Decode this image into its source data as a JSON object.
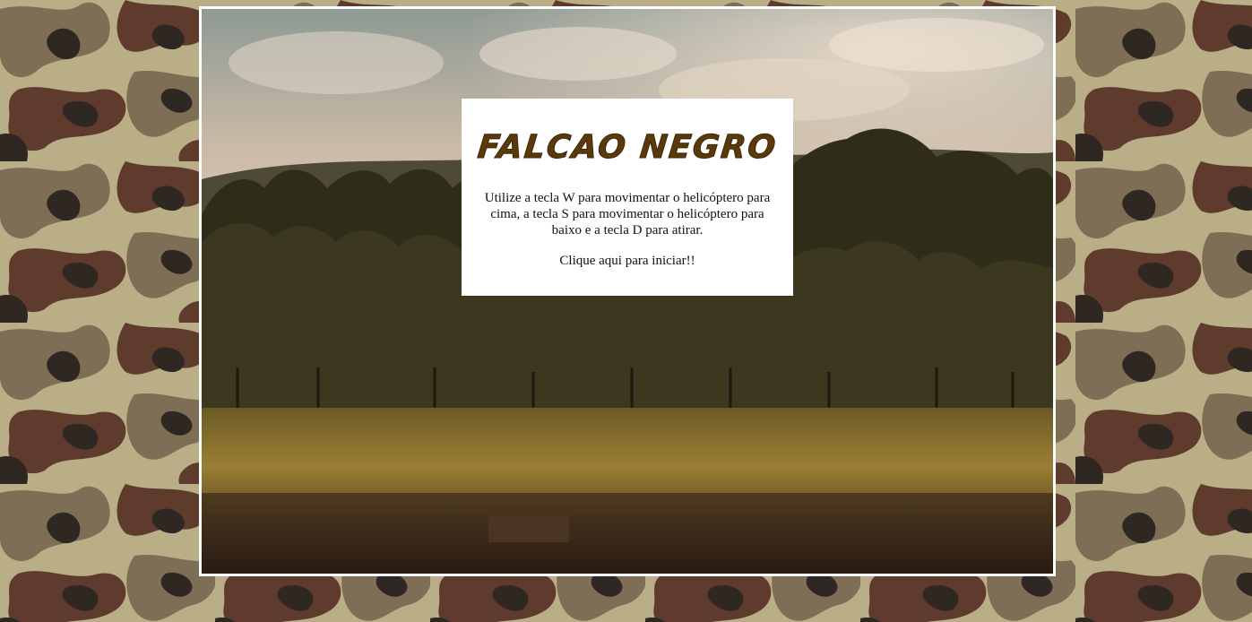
{
  "page": {
    "background": "camouflage pattern",
    "frame_border_color": "#ffffff"
  },
  "colors": {
    "camo_sand": "#b9ae86",
    "camo_olive": "#7d6e55",
    "camo_brown": "#5e3b2c",
    "camo_dark": "#2f2722",
    "title": "#5a3a0a"
  },
  "start_screen": {
    "title": "FALCAO NEGRO",
    "instructions": "Utilize a tecla W para movimentar o helicóptero para cima, a tecla S para movimentar o helicóptero para baixo e a tecla D para atirar.",
    "start_label": "Clique aqui para iniciar!!"
  }
}
